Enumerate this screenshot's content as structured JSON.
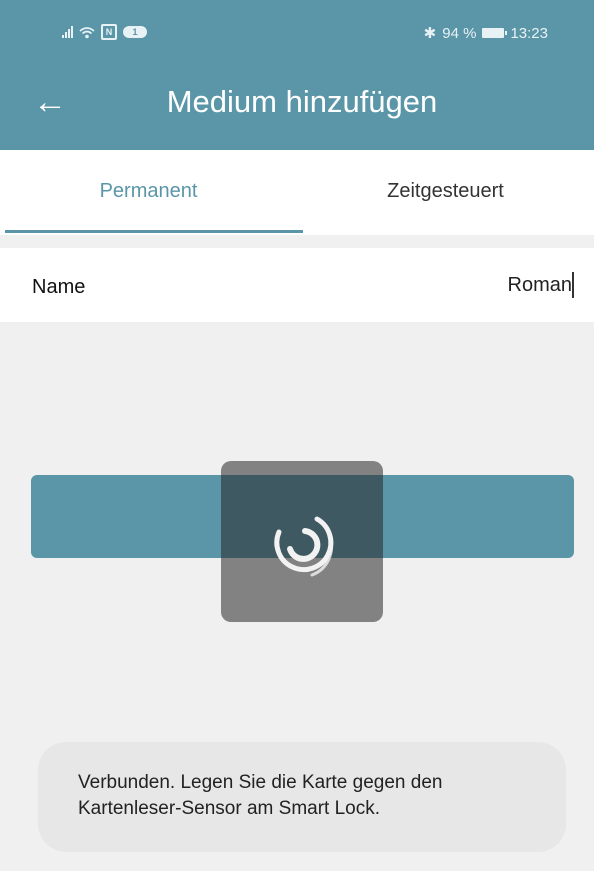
{
  "status_bar": {
    "notification_count": "1",
    "battery_percent": "94 %",
    "time": "13:23"
  },
  "header": {
    "title": "Medium hinzufügen",
    "back_icon": "arrow-left-icon"
  },
  "tabs": [
    {
      "label": "Permanent",
      "active": true
    },
    {
      "label": "Zeitgesteuert",
      "active": false
    }
  ],
  "form": {
    "name_label": "Name",
    "name_value": "Roman"
  },
  "loading_overlay": {
    "icon": "loading-spinner-icon"
  },
  "toast": {
    "line1": "Verbunden. Legen Sie die Karte gegen den",
    "line2": "Kartenleser-Sensor am Smart Lock."
  },
  "colors": {
    "accent": "#5a96a8",
    "background": "#f0f0f0",
    "toast_bg": "#e7e7e7"
  }
}
